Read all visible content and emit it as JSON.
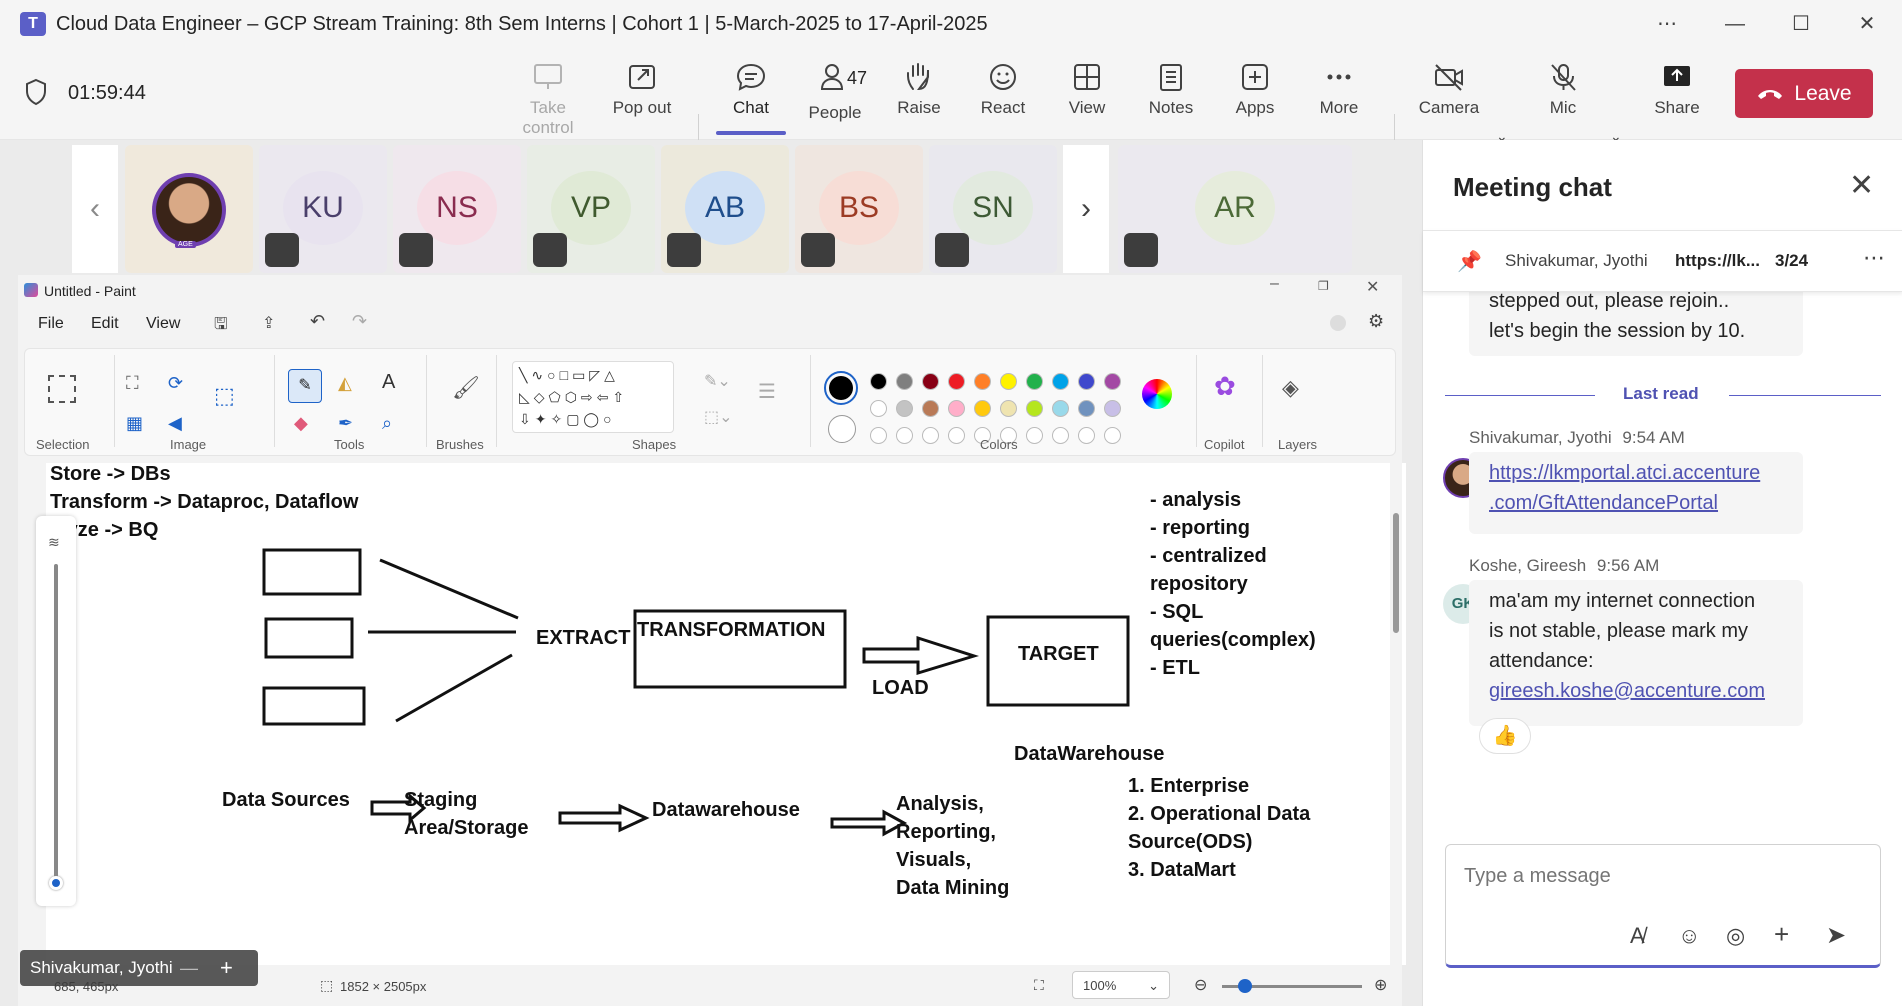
{
  "window": {
    "title": "Cloud Data Engineer – GCP Stream Training: 8th Sem Interns | Cohort 1 | 5-March-2025 to 17-April-2025",
    "logo": "T"
  },
  "meeting": {
    "timer": "01:59:44",
    "toolbar": [
      {
        "key": "take-control",
        "label": "Take control",
        "icon": "monitor-icon"
      },
      {
        "key": "pop-out",
        "label": "Pop out",
        "icon": "pop-out-icon"
      },
      {
        "key": "chat",
        "label": "Chat",
        "icon": "chat-icon"
      },
      {
        "key": "people",
        "label": "People",
        "icon": "people-icon"
      },
      {
        "key": "raise",
        "label": "Raise",
        "icon": "hand-icon"
      },
      {
        "key": "react",
        "label": "React",
        "icon": "smiley-icon"
      },
      {
        "key": "view",
        "label": "View",
        "icon": "grid-icon"
      },
      {
        "key": "notes",
        "label": "Notes",
        "icon": "notes-icon"
      },
      {
        "key": "apps",
        "label": "Apps",
        "icon": "plus-square-icon"
      },
      {
        "key": "more",
        "label": "More",
        "icon": "ellipsis-icon"
      },
      {
        "key": "camera",
        "label": "Camera",
        "icon": "camera-off-icon"
      },
      {
        "key": "mic",
        "label": "Mic",
        "icon": "mic-off-icon"
      },
      {
        "key": "share",
        "label": "Share",
        "icon": "share-icon"
      }
    ],
    "people_count": "47",
    "leave_label": "Leave",
    "accent": "#5b5fc7",
    "leave_color": "#c4314b"
  },
  "participants": [
    {
      "initials": "",
      "photo": true,
      "name_tag": "AGE"
    },
    {
      "initials": "KU",
      "bg": "#e8e3ef",
      "color": "#4a3f6b"
    },
    {
      "initials": "NS",
      "bg": "#f6dee6",
      "color": "#8a2c4f"
    },
    {
      "initials": "VP",
      "bg": "#e0ead6",
      "color": "#3f5a2e"
    },
    {
      "initials": "AB",
      "bg": "#cfe0f5",
      "color": "#1f4e8c"
    },
    {
      "initials": "BS",
      "bg": "#f7ddd6",
      "color": "#9c3b24"
    },
    {
      "initials": "SN",
      "bg": "#e2eadf",
      "color": "#3d5a35"
    },
    {
      "initials": "AR",
      "bg": "#e6ecdc",
      "color": "#4c6a37"
    }
  ],
  "paint": {
    "title": "Untitled - Paint",
    "menu": [
      "File",
      "Edit",
      "View"
    ],
    "groups": [
      "Selection",
      "Image",
      "Tools",
      "Brushes",
      "Shapes",
      "Colors",
      "Copilot",
      "Layers"
    ],
    "palette_row1": [
      "#000000",
      "#7f7f7f",
      "#880015",
      "#ed1c24",
      "#ff7f27",
      "#fff200",
      "#22b14c",
      "#00a2e8",
      "#3f48cc",
      "#a349a4"
    ],
    "palette_row2": [
      "#ffffff",
      "#c3c3c3",
      "#b97a57",
      "#ffaec9",
      "#ffc90e",
      "#efe4b0",
      "#b5e61d",
      "#99d9ea",
      "#7092be",
      "#c8bfe7"
    ],
    "canvas_text": {
      "line1": "Store -> DBs",
      "line2": "Transform -> Dataproc, Dataflow",
      "line3": "alyze -> BQ",
      "extract": "EXTRACT",
      "transformation": "TRANSFORMATION",
      "load": "LOAD",
      "target": "TARGET",
      "list1": "- analysis",
      "list2": "- reporting",
      "list3": "- centralized",
      "list4": "repository",
      "list5": "- SQL",
      "list6": "queries(complex)",
      "list7": "- ETL",
      "dw_label": "DataWarehouse",
      "data_sources": "Data Sources",
      "staging1": "Staging",
      "staging2": "Area/Storage",
      "datawarehouse": "Datawarehouse",
      "analysis1": "Analysis,",
      "analysis2": "Reporting,",
      "analysis3": "Visuals,",
      "analysis4": "Data Mining",
      "types1": "1. Enterprise",
      "types2": "2. Operational Data",
      "types3": "Source(ODS)",
      "types4": "3. DataMart"
    },
    "status": {
      "cursor_pos": "685, 465px",
      "canvas_size": "1852 × 2505px",
      "zoom": "100%"
    }
  },
  "presenter_label": "Shivakumar, Jyothi",
  "chat": {
    "title": "Meeting chat",
    "pinned_sender": "Shivakumar, Jyothi",
    "pinned_text": "https://lk...",
    "pinned_count": "3/24",
    "prev_message_line1": "stepped out, please rejoin..",
    "prev_message_line2": "let's begin the session by 10.",
    "last_read": "Last read",
    "messages": [
      {
        "sender": "Shivakumar, Jyothi",
        "time": "9:54 AM",
        "link1": "https://lkmportal.atci.accenture",
        "link2": ".com/GftAttendancePortal"
      },
      {
        "sender": "Koshe, Gireesh",
        "time": "9:56 AM",
        "initials": "GK",
        "line1": "ma'am my internet connection",
        "line2": "is not stable, please mark my",
        "line3": "attendance:",
        "link": "gireesh.koshe@accenture.com",
        "reaction": "👍"
      }
    ],
    "compose_placeholder": "Type a message"
  }
}
